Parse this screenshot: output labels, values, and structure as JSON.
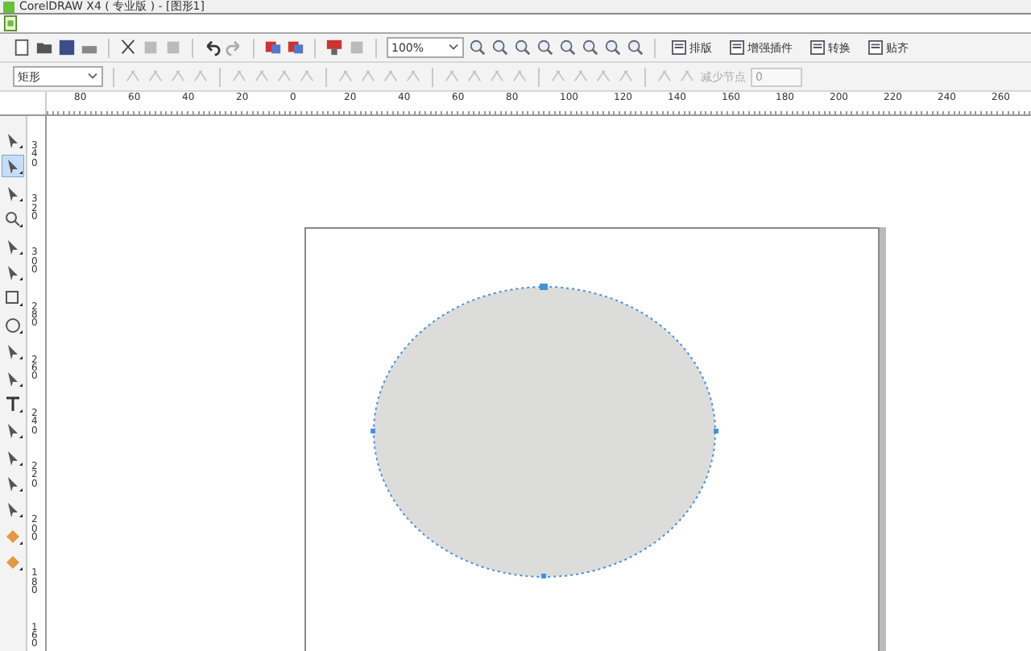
{
  "window": {
    "title": "CorelDRAW X4 ( 专业版 ) - [图形1]"
  },
  "toolbar": {
    "zoom": "100%",
    "buttons": [
      {
        "label": "排版"
      },
      {
        "label": "增强插件"
      },
      {
        "label": "转换"
      },
      {
        "label": "贴齐"
      }
    ]
  },
  "property_bar": {
    "object_type": "矩形",
    "reduce_nodes_label": "减少节点",
    "reduce_nodes_value": "0"
  },
  "toolbox": {
    "items": [
      {
        "selected": false
      },
      {
        "selected": true
      },
      {
        "selected": false
      },
      {
        "selected": false
      },
      {
        "selected": false
      },
      {
        "selected": false
      },
      {
        "selected": false
      },
      {
        "selected": false
      },
      {
        "selected": false
      },
      {
        "selected": false
      },
      {
        "selected": false
      },
      {
        "selected": false
      },
      {
        "selected": false
      },
      {
        "selected": false
      },
      {
        "selected": false
      },
      {
        "selected": false
      },
      {
        "selected": false
      }
    ]
  },
  "horizontal_ruler": [
    "80",
    "60",
    "40",
    "20",
    "0",
    "20",
    "40",
    "60",
    "80",
    "100",
    "120",
    "140",
    "160",
    "180",
    "200",
    "220",
    "240",
    "260"
  ],
  "vertical_ruler": [
    "340",
    "320",
    "300",
    "280",
    "260",
    "240",
    "220",
    "200",
    "180",
    "160"
  ]
}
